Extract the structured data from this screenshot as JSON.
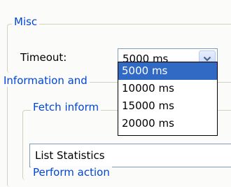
{
  "misc": {
    "legend": "Misc",
    "timeout_label": "Timeout:",
    "timeout_value": "5000 ms",
    "timeout_options": [
      "5000 ms",
      "10000 ms",
      "15000 ms",
      "20000 ms"
    ]
  },
  "information": {
    "legend": "Information and"
  },
  "fetch": {
    "legend": "Fetch inform",
    "value": "List Statistics"
  },
  "perform": {
    "legend": "Perform action"
  },
  "icons": {
    "dropdown": "chevron-down-icon"
  },
  "colors": {
    "legend_text": "#0046d5",
    "selected_option": "#316ac5",
    "group_border": "#d0d0bf"
  }
}
